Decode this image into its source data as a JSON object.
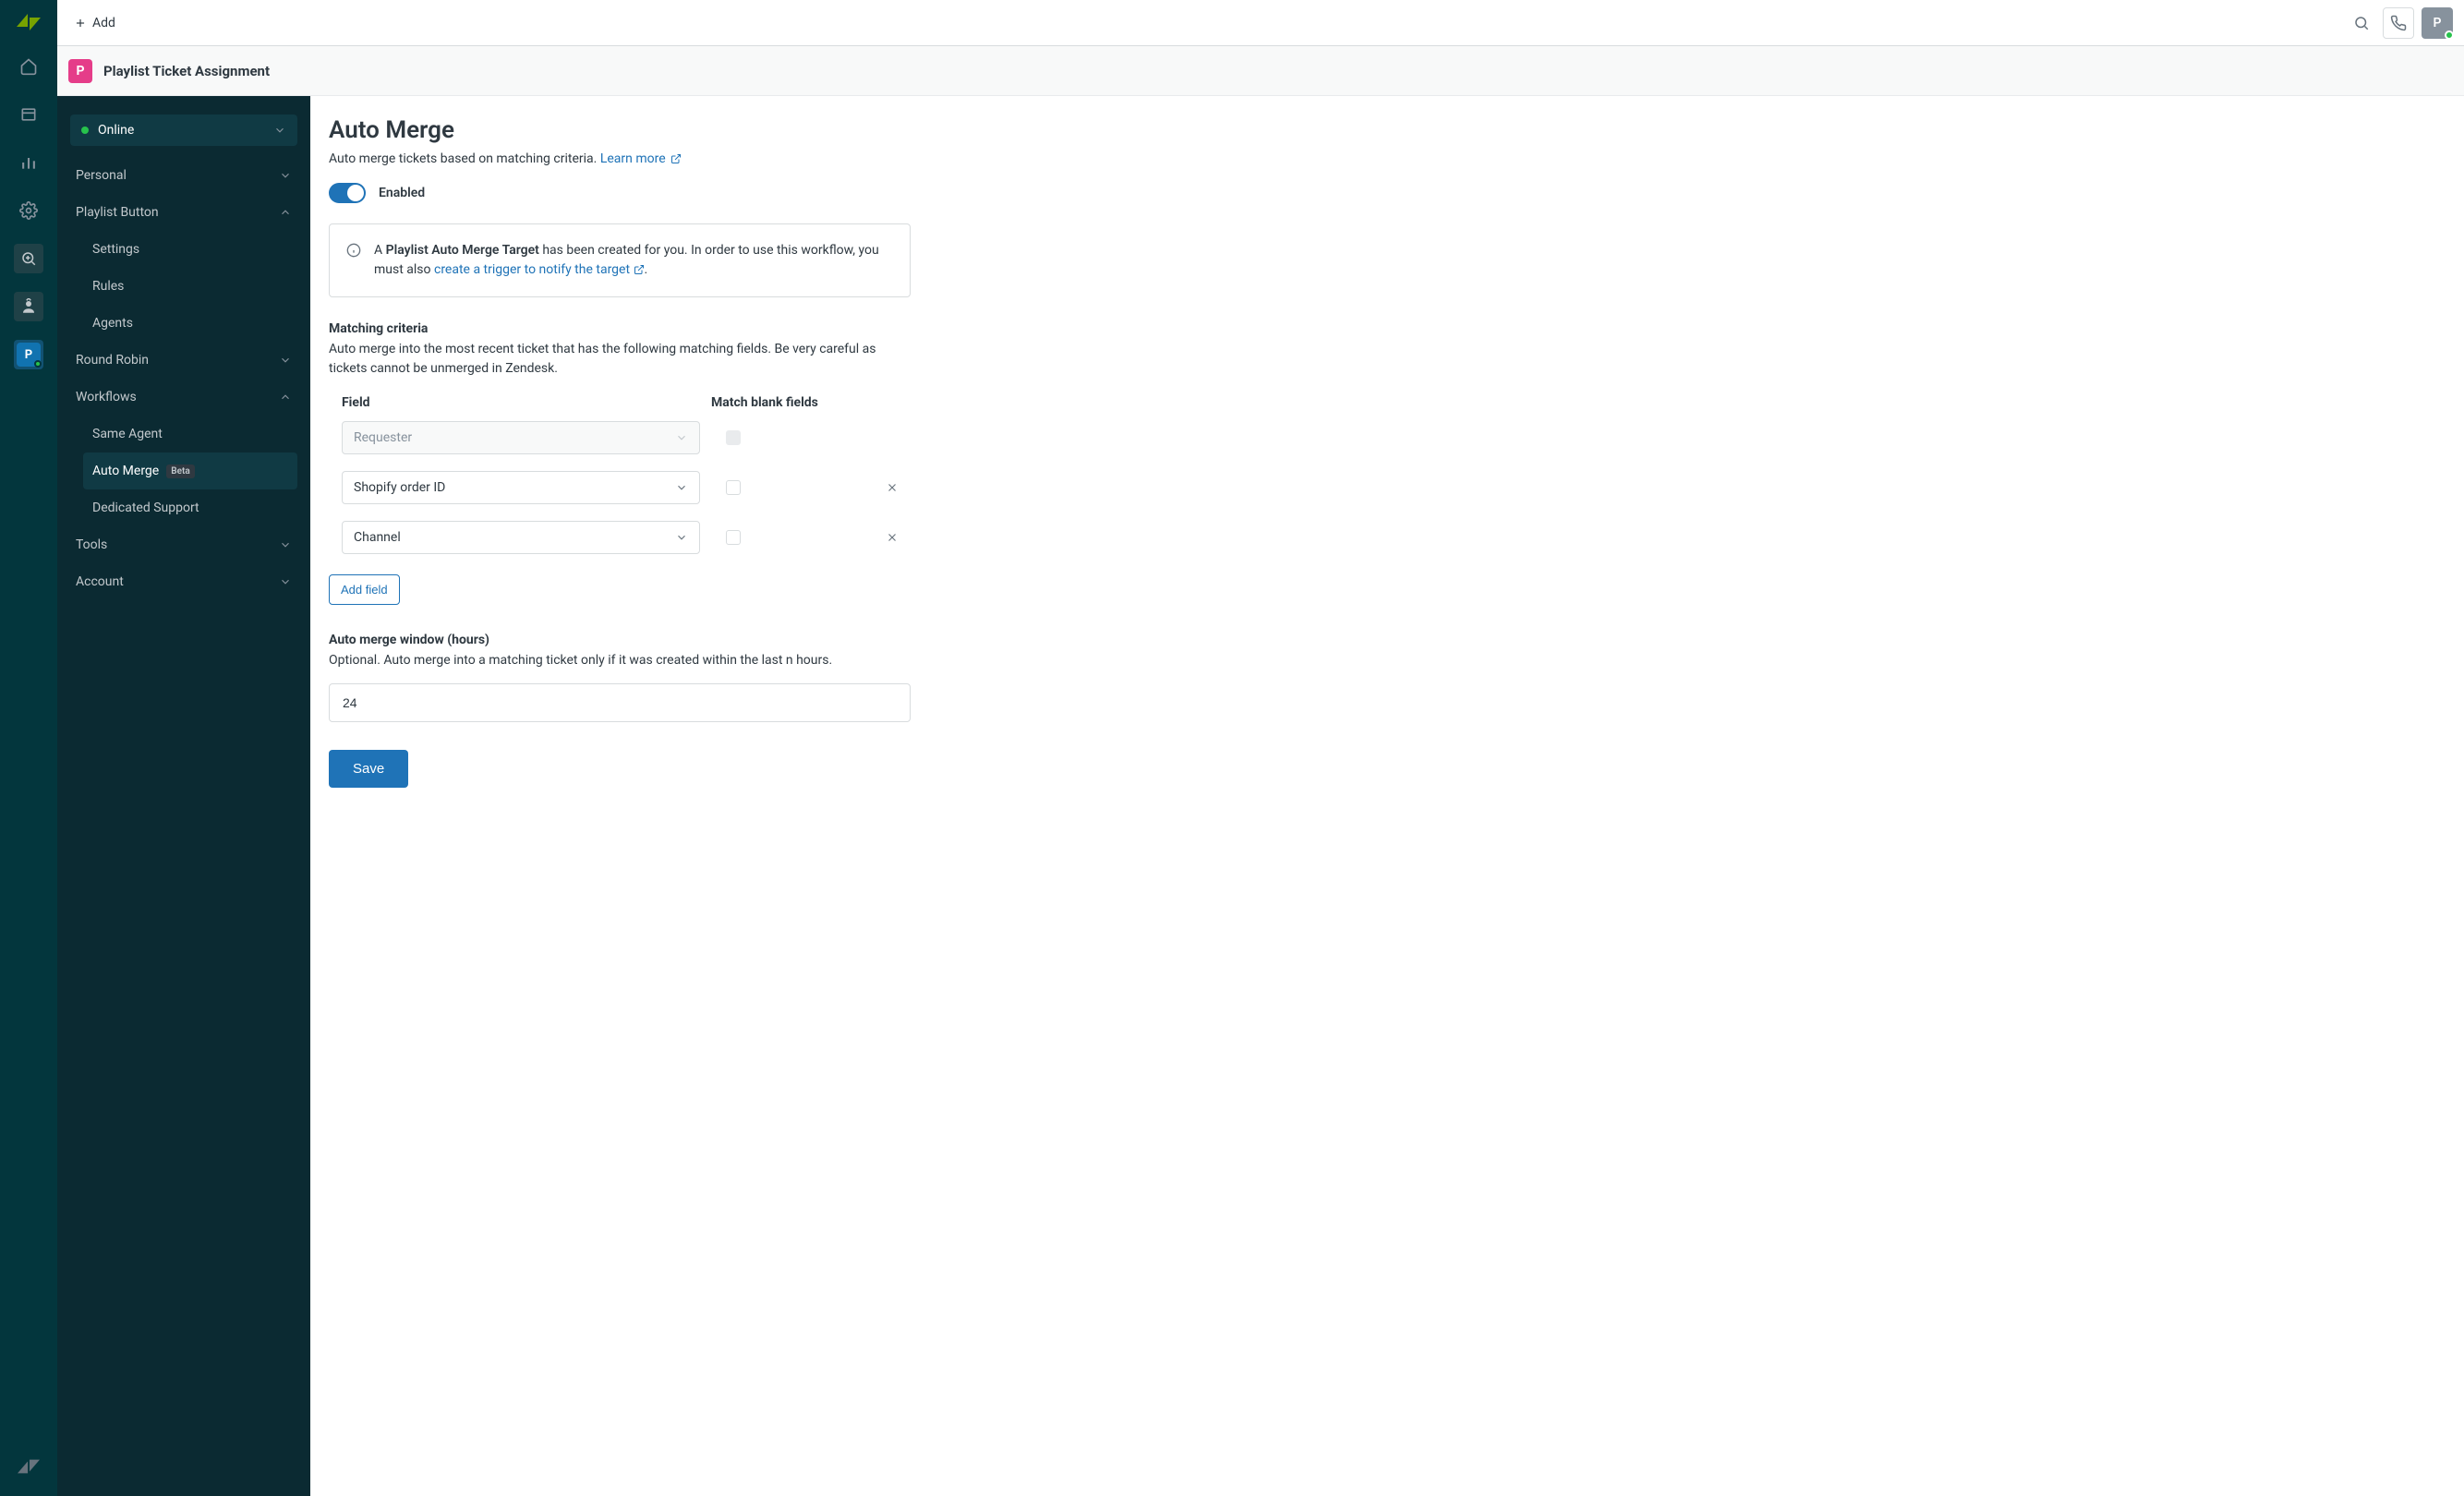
{
  "topbar": {
    "add_label": "Add"
  },
  "page_header": {
    "app_letter": "P",
    "title": "Playlist Ticket Assignment"
  },
  "sidebar": {
    "status_label": "Online",
    "items": [
      {
        "label": "Personal",
        "expanded": false,
        "sub": []
      },
      {
        "label": "Playlist Button",
        "expanded": true,
        "sub": [
          {
            "label": "Settings"
          },
          {
            "label": "Rules"
          },
          {
            "label": "Agents"
          }
        ]
      },
      {
        "label": "Round Robin",
        "expanded": false,
        "sub": []
      },
      {
        "label": "Workflows",
        "expanded": true,
        "sub": [
          {
            "label": "Same Agent"
          },
          {
            "label": "Auto Merge",
            "active": true,
            "badge": "Beta"
          },
          {
            "label": "Dedicated Support"
          }
        ]
      },
      {
        "label": "Tools",
        "expanded": false,
        "sub": []
      },
      {
        "label": "Account",
        "expanded": false,
        "sub": []
      }
    ]
  },
  "content": {
    "title": "Auto Merge",
    "subtitle": "Auto merge tickets based on matching criteria.",
    "learn_more": "Learn more",
    "enabled_label": "Enabled",
    "alert_prefix": "A ",
    "alert_bold": "Playlist Auto Merge Target",
    "alert_mid": " has been created for you. In order to use this workflow, you must also ",
    "alert_link": "create a trigger to notify the target",
    "alert_suffix": ".",
    "matching_title": "Matching criteria",
    "matching_desc": "Auto merge into the most recent ticket that has the following matching fields. Be very careful as tickets cannot be unmerged in Zendesk.",
    "col_field": "Field",
    "col_blank": "Match blank fields",
    "fields": [
      {
        "value": "Requester",
        "disabled": true,
        "blank_disabled": true,
        "removable": false
      },
      {
        "value": "Shopify order ID",
        "disabled": false,
        "blank_disabled": false,
        "removable": true
      },
      {
        "value": "Channel",
        "disabled": false,
        "blank_disabled": false,
        "removable": true
      }
    ],
    "add_field_label": "Add field",
    "window_title": "Auto merge window (hours)",
    "window_desc": "Optional. Auto merge into a matching ticket only if it was created within the last n hours.",
    "window_value": "24",
    "save_label": "Save"
  }
}
